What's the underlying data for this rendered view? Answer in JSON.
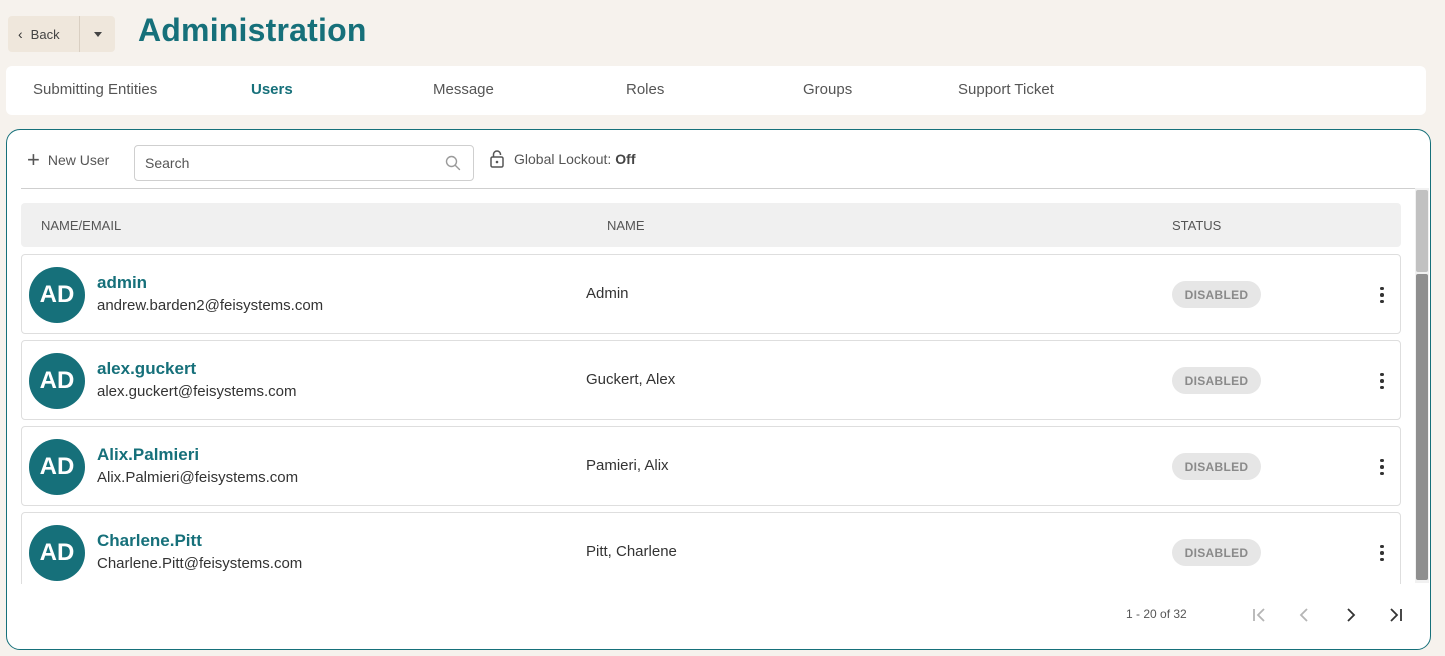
{
  "header": {
    "back_label": "Back",
    "title": "Administration"
  },
  "tabs": [
    {
      "label": "Submitting Entities",
      "active": false
    },
    {
      "label": "Users",
      "active": true
    },
    {
      "label": "Message",
      "active": false
    },
    {
      "label": "Roles",
      "active": false
    },
    {
      "label": "Groups",
      "active": false
    },
    {
      "label": "Support Ticket",
      "active": false
    }
  ],
  "toolbar": {
    "new_user_label": "New User",
    "search_placeholder": "Search",
    "search_value": "",
    "lockout_label": "Global Lockout:",
    "lockout_value": "Off"
  },
  "table": {
    "columns": [
      "NAME/EMAIL",
      "NAME",
      "STATUS"
    ],
    "rows": [
      {
        "initials": "AD",
        "username": "admin",
        "email": "andrew.barden2@feisystems.com",
        "name": "Admin",
        "status": "DISABLED"
      },
      {
        "initials": "AD",
        "username": "alex.guckert",
        "email": "alex.guckert@feisystems.com",
        "name": "Guckert, Alex",
        "status": "DISABLED"
      },
      {
        "initials": "AD",
        "username": "Alix.Palmieri",
        "email": "Alix.Palmieri@feisystems.com",
        "name": "Pamieri, Alix",
        "status": "DISABLED"
      },
      {
        "initials": "AD",
        "username": "Charlene.Pitt",
        "email": "Charlene.Pitt@feisystems.com",
        "name": "Pitt, Charlene",
        "status": "DISABLED"
      }
    ]
  },
  "pagination": {
    "range_text": "1 - 20 of 32"
  },
  "colors": {
    "accent": "#16707a",
    "background": "#f6f2ed",
    "badge_bg": "#e6e6e6"
  },
  "icons": {
    "back": "chevron-left-icon",
    "dropdown": "caret-down-icon",
    "new_user": "plus-icon",
    "search": "search-icon",
    "lockout": "lock-open-icon",
    "row_menu": "kebab-menu-icon",
    "first_page": "first-page-icon",
    "prev_page": "prev-page-icon",
    "next_page": "next-page-icon",
    "last_page": "last-page-icon"
  }
}
